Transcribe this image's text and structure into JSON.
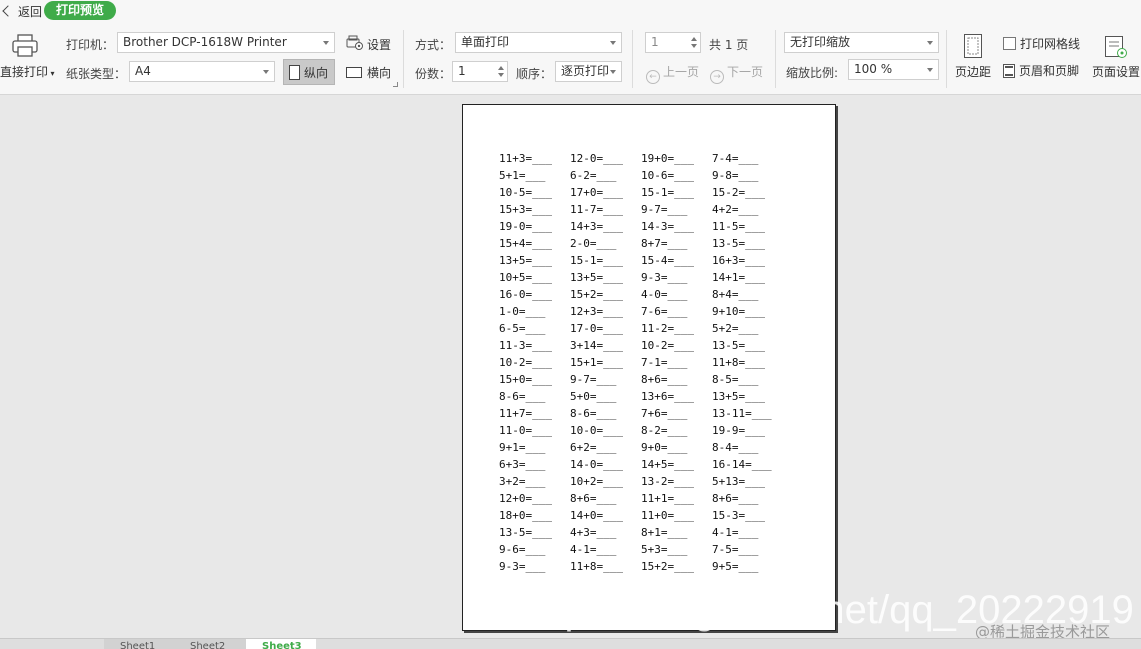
{
  "header": {
    "back_label": "返回",
    "mode_label": "打印预览"
  },
  "print_direct": {
    "label": "直接打印"
  },
  "printer": {
    "label": "打印机：",
    "value": "Brother DCP-1618W Printer",
    "settings_label": "设置"
  },
  "paper": {
    "label": "纸张类型：",
    "value": "A4",
    "portrait_label": "纵向",
    "landscape_label": "横向"
  },
  "mode": {
    "label": "方式：",
    "value": "单面打印"
  },
  "copies": {
    "label": "份数：",
    "value": "1",
    "order_label": "顺序：",
    "order_value": "逐页打印"
  },
  "pagination": {
    "current": "1",
    "total_label": "共 1 页",
    "prev_label": "上一页",
    "next_label": "下一页"
  },
  "scale": {
    "mode_value": "无打印缩放",
    "ratio_label": "缩放比例:",
    "ratio_value": "100 %"
  },
  "options": {
    "gridlines_label": "打印网格线",
    "header_footer_label": "页眉和页脚",
    "margins_label": "页边距",
    "page_setup_label": "页面设置"
  },
  "worksheet": {
    "rows": [
      [
        "11+3=___",
        "12-0=___",
        "19+0=___",
        "7-4=___"
      ],
      [
        "5+1=___",
        "6-2=___",
        "10-6=___",
        "9-8=___"
      ],
      [
        "10-5=___",
        "17+0=___",
        "15-1=___",
        "15-2=___"
      ],
      [
        "15+3=___",
        "11-7=___",
        "9-7=___",
        "4+2=___"
      ],
      [
        "19-0=___",
        "14+3=___",
        "14-3=___",
        "11-5=___"
      ],
      [
        "15+4=___",
        "2-0=___",
        "8+7=___",
        "13-5=___"
      ],
      [
        "13+5=___",
        "15-1=___",
        "15-4=___",
        "16+3=___"
      ],
      [
        "10+5=___",
        "13+5=___",
        "9-3=___",
        "14+1=___"
      ],
      [
        "16-0=___",
        "15+2=___",
        "4-0=___",
        "8+4=___"
      ],
      [
        "1-0=___",
        "12+3=___",
        "7-6=___",
        "9+10=___"
      ],
      [
        "6-5=___",
        "17-0=___",
        "11-2=___",
        "5+2=___"
      ],
      [
        "11-3=___",
        "3+14=___",
        "10-2=___",
        "13-5=___"
      ],
      [
        "10-2=___",
        "15+1=___",
        "7-1=___",
        "11+8=___"
      ],
      [
        "15+0=___",
        "9-7=___",
        "8+6=___",
        "8-5=___"
      ],
      [
        "8-6=___",
        "5+0=___",
        "13+6=___",
        "13+5=___"
      ],
      [
        "11+7=___",
        "8-6=___",
        "7+6=___",
        "13-11=___"
      ],
      [
        "11-0=___",
        "10-0=___",
        "8-2=___",
        "19-9=___"
      ],
      [
        "9+1=___",
        "6+2=___",
        "9+0=___",
        "8-4=___"
      ],
      [
        "6+3=___",
        "14-0=___",
        "14+5=___",
        "16-14=___"
      ],
      [
        "3+2=___",
        "10+2=___",
        "13-2=___",
        "5+13=___"
      ],
      [
        "12+0=___",
        "8+6=___",
        "11+1=___",
        "8+6=___"
      ],
      [
        "18+0=___",
        "14+0=___",
        "11+0=___",
        "15-3=___"
      ],
      [
        "13-5=___",
        "4+3=___",
        "8+1=___",
        "4-1=___"
      ],
      [
        "9-6=___",
        "4-1=___",
        "5+3=___",
        "7-5=___"
      ],
      [
        "9-3=___",
        "11+8=___",
        "15+2=___",
        "9+5=___"
      ]
    ]
  },
  "watermark": {
    "csdn": "https://blog.csdn.net/qq_20222919",
    "juejin": "@稀土掘金技术社区"
  },
  "sheet_tabs": [
    "Sheet1",
    "Sheet2",
    "Sheet3"
  ],
  "colors": {
    "accent": "#3fab49",
    "toolbar_bg": "#f7f7f7",
    "canvas_bg": "#e8e8e8"
  }
}
